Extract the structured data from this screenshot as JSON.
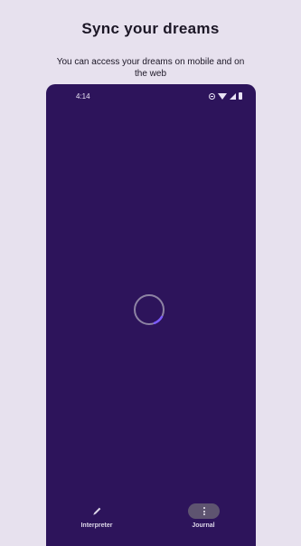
{
  "promo": {
    "headline": "Sync your dreams",
    "subtitle": "You can access your dreams on mobile and on the web"
  },
  "device": {
    "status_bar": {
      "time": "4:14",
      "icons": [
        "do-not-disturb-icon",
        "wifi-icon",
        "signal-icon",
        "battery-icon"
      ]
    },
    "loading": {
      "icon": "loading-spinner-icon"
    },
    "bottom_nav": {
      "items": [
        {
          "label": "Interpreter",
          "icon": "pencil-icon",
          "selected": false
        },
        {
          "label": "Journal",
          "icon": "more-vertical-icon",
          "selected": true
        }
      ]
    }
  },
  "colors": {
    "background": "#e7e1ee",
    "screen": "#2d145b",
    "accent": "#7c5cff"
  }
}
